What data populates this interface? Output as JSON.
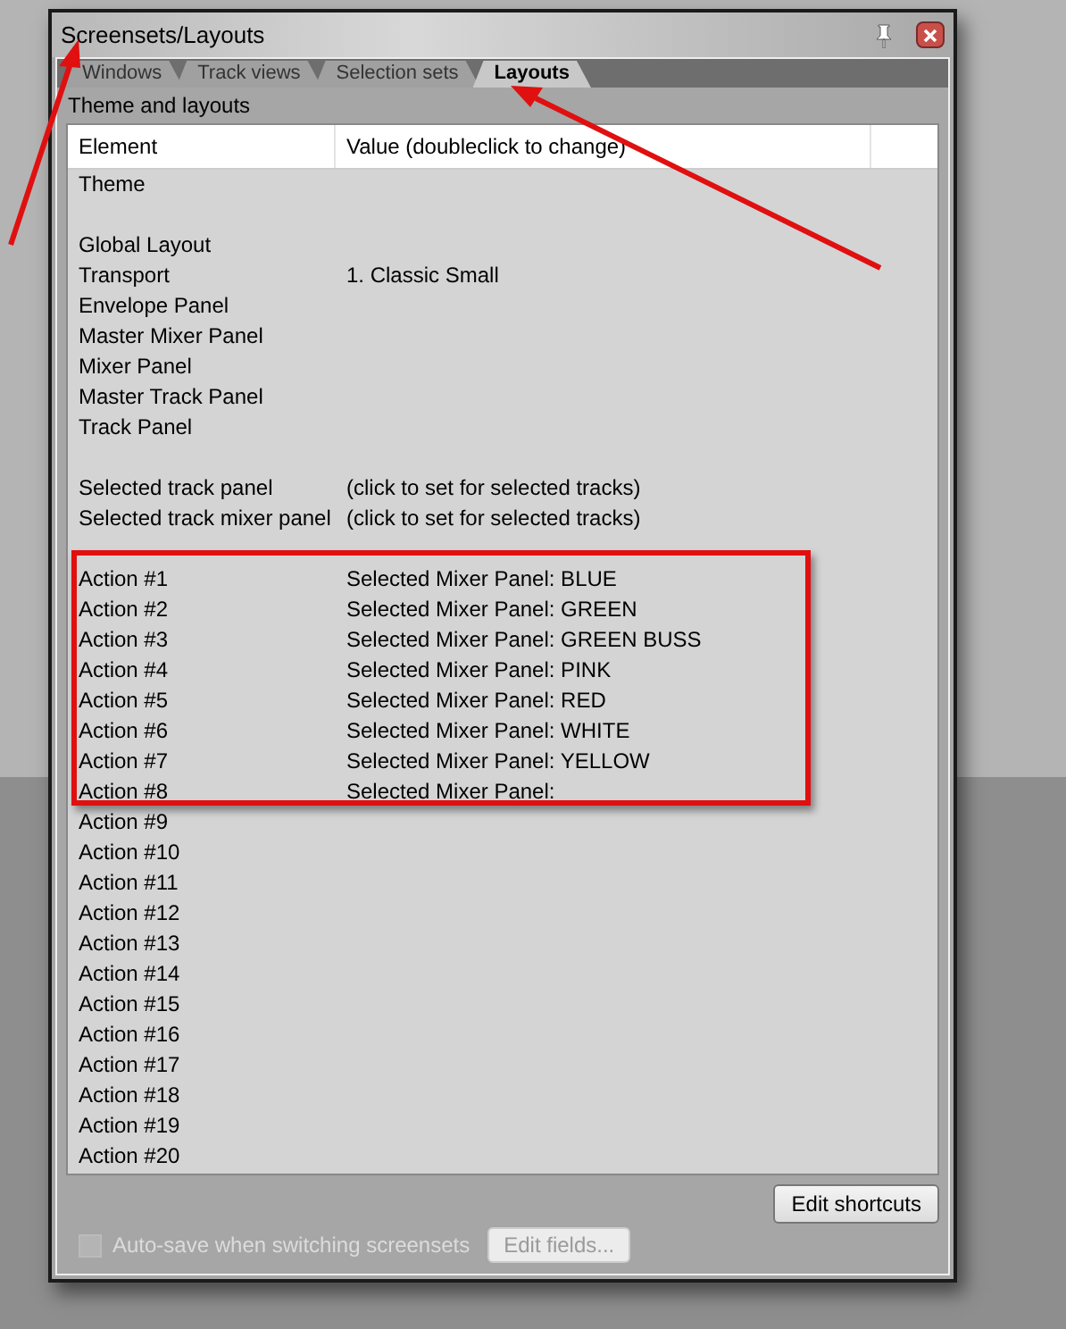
{
  "window": {
    "title": "Screensets/Layouts"
  },
  "tabs": [
    {
      "label": "Windows",
      "selected": false
    },
    {
      "label": "Track views",
      "selected": false
    },
    {
      "label": "Selection sets",
      "selected": false
    },
    {
      "label": "Layouts",
      "selected": true
    }
  ],
  "section_label": "Theme and layouts",
  "table": {
    "columns": [
      "Element",
      "Value (doubleclick to change)"
    ],
    "rows": [
      {
        "kind": "item",
        "element": "Theme"
      },
      {
        "kind": "blank"
      },
      {
        "kind": "item",
        "element": "Global Layout"
      },
      {
        "kind": "item",
        "element": "Transport",
        "value": "1. Classic Small"
      },
      {
        "kind": "item",
        "element": "Envelope Panel"
      },
      {
        "kind": "item",
        "element": "Master Mixer Panel"
      },
      {
        "kind": "item",
        "element": "Mixer Panel"
      },
      {
        "kind": "item",
        "element": "Master Track Panel"
      },
      {
        "kind": "item",
        "element": "Track Panel"
      },
      {
        "kind": "blank"
      },
      {
        "kind": "item",
        "element": "Selected track panel",
        "value": "(click to set for selected tracks)"
      },
      {
        "kind": "item",
        "element": "Selected track mixer panel",
        "value": "(click to set for selected tracks)"
      },
      {
        "kind": "blank"
      },
      {
        "kind": "item",
        "element": "Action #1",
        "value": "Selected Mixer Panel: BLUE"
      },
      {
        "kind": "item",
        "element": "Action #2",
        "value": "Selected Mixer Panel: GREEN"
      },
      {
        "kind": "item",
        "element": "Action #3",
        "value": "Selected Mixer Panel: GREEN BUSS"
      },
      {
        "kind": "item",
        "element": "Action #4",
        "value": "Selected Mixer Panel: PINK"
      },
      {
        "kind": "item",
        "element": "Action #5",
        "value": "Selected Mixer Panel: RED"
      },
      {
        "kind": "item",
        "element": "Action #6",
        "value": "Selected Mixer Panel: WHITE"
      },
      {
        "kind": "item",
        "element": "Action #7",
        "value": "Selected Mixer Panel: YELLOW"
      },
      {
        "kind": "item",
        "element": "Action #8",
        "value": "Selected Mixer Panel:"
      },
      {
        "kind": "item",
        "element": "Action #9"
      },
      {
        "kind": "item",
        "element": "Action #10"
      },
      {
        "kind": "item",
        "element": "Action #11"
      },
      {
        "kind": "item",
        "element": "Action #12"
      },
      {
        "kind": "item",
        "element": "Action #13"
      },
      {
        "kind": "item",
        "element": "Action #14"
      },
      {
        "kind": "item",
        "element": "Action #15"
      },
      {
        "kind": "item",
        "element": "Action #16"
      },
      {
        "kind": "item",
        "element": "Action #17"
      },
      {
        "kind": "item",
        "element": "Action #18"
      },
      {
        "kind": "item",
        "element": "Action #19"
      },
      {
        "kind": "item",
        "element": "Action #20"
      }
    ]
  },
  "buttons": {
    "edit_shortcuts": "Edit shortcuts",
    "edit_fields": {
      "label": "Edit fields...",
      "disabled": true
    }
  },
  "auto_save": {
    "label": "Auto-save when switching screensets",
    "checked": false,
    "disabled": true
  }
}
